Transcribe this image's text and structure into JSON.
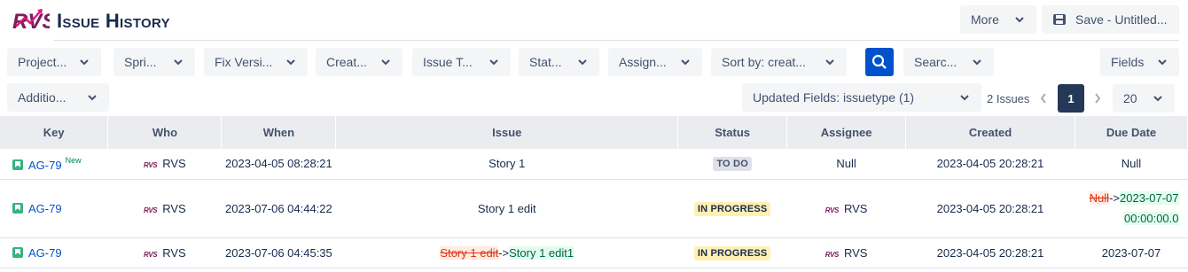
{
  "header": {
    "logo_text": "RVS",
    "title": "Issue History",
    "more_label": "More",
    "save_label": "Save - Untitled..."
  },
  "filters": {
    "project": "Project...",
    "sprint": "Spri...",
    "fix_version": "Fix Versi...",
    "created": "Creat...",
    "issue_type": "Issue T...",
    "status": "Stat...",
    "assignee": "Assign...",
    "sort": "Sort by: creat...",
    "search": "Searc...",
    "fields": "Fields",
    "additional": "Additio...",
    "updated_fields": "Updated Fields: issuetype (1)"
  },
  "pagination": {
    "count_text": "2 Issues",
    "current_page": "1",
    "page_size": "20"
  },
  "table": {
    "columns": [
      "Key",
      "Who",
      "When",
      "Issue",
      "Status",
      "Assignee",
      "Created",
      "Due Date"
    ],
    "rows": [
      {
        "key": "AG-79",
        "new_tag": "New",
        "who": "RVS",
        "when": "2023-04-05 08:28:21",
        "issue": "Story 1",
        "status": "TO DO",
        "assignee": "Null",
        "created": "2023-04-05 20:28:21",
        "due": "Null"
      },
      {
        "key": "AG-79",
        "who": "RVS",
        "when": "2023-07-06 04:44:22",
        "issue": "Story 1 edit",
        "status": "IN PROGRESS",
        "assignee": "RVS",
        "created": "2023-04-05 20:28:21",
        "due_old": "Null",
        "due_arrow": "->",
        "due_new": "2023-07-07",
        "due_time": "00:00:00.0"
      },
      {
        "key": "AG-79",
        "who": "RVS",
        "when": "2023-07-06 04:45:35",
        "issue_old": "Story 1 edit",
        "issue_arrow": "->",
        "issue_new": "Story 1 edit1",
        "status": "IN PROGRESS",
        "assignee": "RVS",
        "created": "2023-04-05 20:28:21",
        "due": "2023-07-07"
      }
    ]
  },
  "colors": {
    "primary": "#0052cc",
    "logo_purple": "#7b1e5a",
    "logo_pink": "#e0157b",
    "story_green": "#36b37e"
  }
}
